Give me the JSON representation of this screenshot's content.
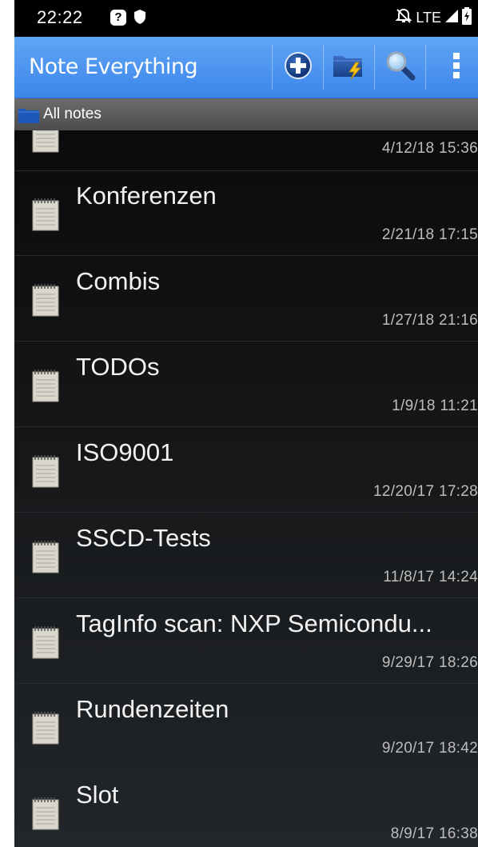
{
  "status_bar": {
    "time": "22:22",
    "help_glyph": "?",
    "network": "LTE",
    "icons": [
      "help-icon",
      "shield-icon",
      "alarm-off-icon",
      "signal-icon",
      "battery-charging-icon"
    ]
  },
  "action_bar": {
    "title": "Note Everything",
    "actions": [
      "add-note-icon",
      "folder-lightning-icon",
      "search-icon",
      "overflow-menu-icon"
    ],
    "colors": {
      "top": "#5fa5f5",
      "bottom": "#3d86ea"
    }
  },
  "breadcrumb": {
    "label": "All notes",
    "icon": "folder-icon"
  },
  "notes": [
    {
      "title": "",
      "date": "4/12/18 15:36"
    },
    {
      "title": "Konferenzen",
      "date": "2/21/18 17:15"
    },
    {
      "title": "Combis",
      "date": "1/27/18 21:16"
    },
    {
      "title": "TODOs",
      "date": "1/9/18 11:21"
    },
    {
      "title": "ISO9001",
      "date": "12/20/17 17:28"
    },
    {
      "title": "SSCD-Tests",
      "date": "11/8/17 14:24"
    },
    {
      "title": "TagInfo scan: NXP Semicondu...",
      "date": "9/29/17 18:26"
    },
    {
      "title": "Rundenzeiten",
      "date": "9/20/17 18:42"
    },
    {
      "title": "Slot",
      "date": "8/9/17 16:38"
    }
  ]
}
